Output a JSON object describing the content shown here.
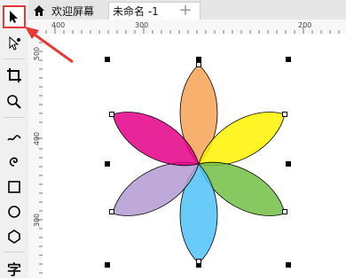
{
  "tabs": {
    "welcome": "欢迎屏幕",
    "document": "未命名 -1",
    "add_symbol": "+"
  },
  "rulers": {
    "top": [
      "400",
      "300",
      "200"
    ],
    "left": [
      "500",
      "400",
      "300"
    ]
  },
  "toolbox": {
    "bottom_tool_label": "字"
  },
  "colors": {
    "flower_petals": [
      "#F7A255",
      "#FFF200",
      "#72BF44",
      "#4FC3F7",
      "#B39AD1",
      "#E40087"
    ],
    "annotation": "#e53935"
  },
  "icons": [
    "pointer-icon",
    "shape-edit-icon",
    "crop-icon",
    "zoom-icon",
    "freehand-icon",
    "spiral-icon",
    "rectangle-icon",
    "ellipse-icon",
    "polygon-icon",
    "text-icon",
    "home-icon"
  ]
}
